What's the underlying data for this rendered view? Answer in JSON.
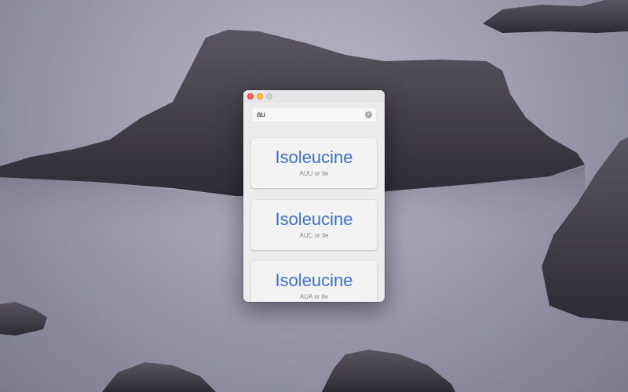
{
  "window": {
    "buttons": {
      "close": "close",
      "minimize": "minimize",
      "zoom": "zoom"
    }
  },
  "search": {
    "value": "au",
    "clear_icon": "clear-circle-icon",
    "clear_glyph": "×"
  },
  "results": [
    {
      "name": "Isoleucine",
      "codon": "AUU or Ile"
    },
    {
      "name": "Isoleucine",
      "codon": "AUC or Ile"
    },
    {
      "name": "Isoleucine",
      "codon": "AUA or Ile"
    }
  ],
  "colors": {
    "accent_text": "#3b6fd6",
    "close": "#ff5f57",
    "minimize": "#febc2e",
    "zoom_disabled": "#cfcfcf"
  }
}
